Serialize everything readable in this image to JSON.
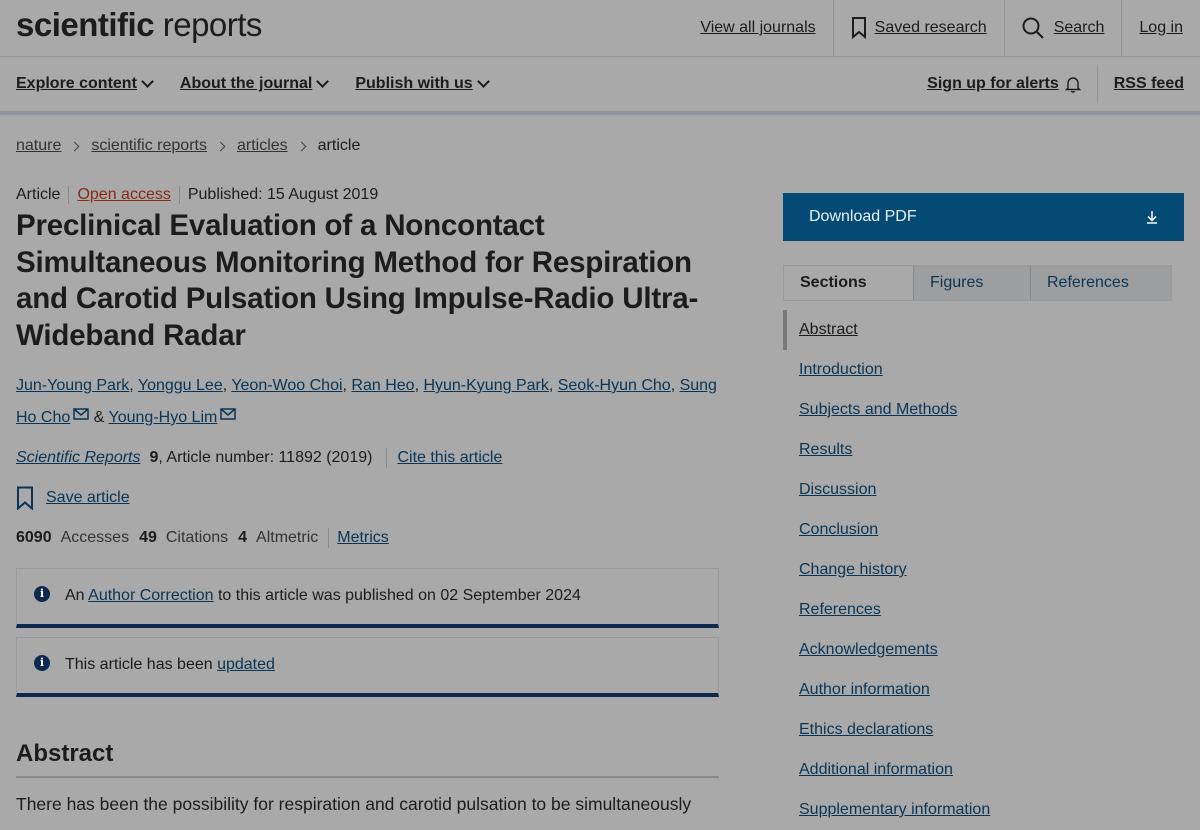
{
  "header": {
    "logo_bold": "scientific",
    "logo_light": " reports",
    "links": [
      "View all journals",
      "Saved research",
      "Search",
      "Log in"
    ]
  },
  "nav": {
    "left": [
      "Explore content",
      "About the journal",
      "Publish with us"
    ],
    "alerts": "Sign up for alerts",
    "rss": "RSS feed"
  },
  "breadcrumb": [
    "nature",
    "scientific reports",
    "articles",
    "article"
  ],
  "article": {
    "type": "Article",
    "access": "Open access",
    "published": "Published: 15 August 2019",
    "title": "Preclinical Evaluation of a Noncontact Simultaneous Monitoring Method for Respiration and Carotid Pulsation Using Impulse-Radio Ultra-Wideband Radar",
    "authors": [
      "Jun-Young Park",
      "Yonggu Lee",
      "Yeon-Woo Choi",
      "Ran Heo",
      "Hyun-Kyung Park",
      "Seok-Hyun Cho",
      "Sung Ho Cho",
      "Young-Hyo Lim"
    ],
    "author_sep": ", ",
    "author_and": " & ",
    "journal": "Scientific Reports",
    "volume": "9",
    "article_number": ", Article number: 11892 (2019)",
    "cite": "Cite this article",
    "save": "Save article",
    "metrics": {
      "accesses_value": "6090",
      "accesses_label": "Accesses",
      "citations_value": "49",
      "citations_label": "Citations",
      "altmetric_value": "4",
      "altmetric_label": "Altmetric",
      "metrics_link": "Metrics"
    },
    "notice1": {
      "pre": "An ",
      "link": "Author Correction",
      "post": " to this article was published on 02 September 2024"
    },
    "notice2": {
      "pre": "This article has been ",
      "link": "updated"
    },
    "abstract_heading": "Abstract",
    "abstract_text": "There has been the possibility for respiration and carotid pulsation to be simultaneously"
  },
  "sidebar": {
    "download": "Download PDF",
    "tabs": [
      "Sections",
      "Figures",
      "References"
    ],
    "sections": [
      "Abstract",
      "Introduction",
      "Subjects and Methods",
      "Results",
      "Discussion",
      "Conclusion",
      "Change history",
      "References",
      "Acknowledgements",
      "Author information",
      "Ethics declarations",
      "Additional information",
      "Supplementary information"
    ]
  },
  "colors": {
    "background": "#a9a9a9",
    "link": "#0a3556",
    "pdf_button": "#044a75",
    "open_access": "#8a2a12",
    "notice_border": "#0d2a4e"
  }
}
